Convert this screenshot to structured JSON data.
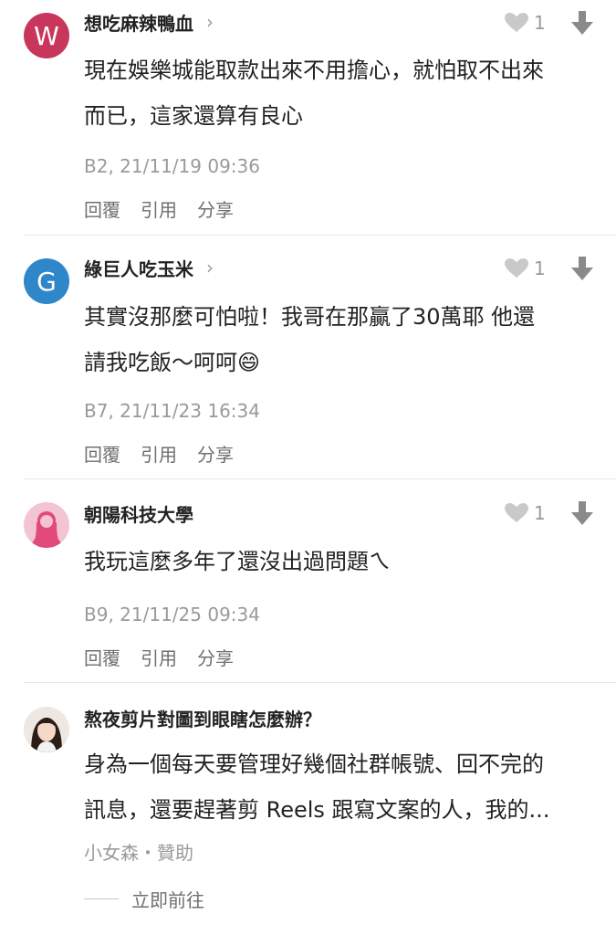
{
  "comments": [
    {
      "avatar_letter": "W",
      "avatar_color": "#c8365b",
      "username": "想吃麻辣鴨血",
      "chevron": "›",
      "likes": "1",
      "body_lines": [
        "現在娛樂城能取款出來不用擔心，就怕取不出來",
        "而已，這家還算有良心"
      ],
      "meta": "B2, 21/11/19 09:36",
      "actions": [
        "回覆",
        "引用",
        "分享"
      ]
    },
    {
      "avatar_letter": "G",
      "avatar_color": "#2f86c9",
      "username": "綠巨人吃玉米",
      "chevron": "›",
      "likes": "1",
      "body_lines": [
        "其實沒那麼可怕啦！我哥在那贏了30萬耶 他還",
        "請我吃飯～呵呵"
      ],
      "emoji": "😄",
      "meta": "B7, 21/11/23 16:34",
      "actions": [
        "回覆",
        "引用",
        "分享"
      ]
    },
    {
      "avatar_color": "#f3c4d1",
      "avatar_figure_color": "#e24a7c",
      "username": "朝陽科技大學",
      "likes": "1",
      "body_lines": [
        "我玩這麼多年了還沒出過問題ㄟ"
      ],
      "meta": "B9, 21/11/25 09:34",
      "actions": [
        "回覆",
        "引用",
        "分享"
      ]
    }
  ],
  "ad": {
    "title": "熬夜剪片對圖到眼瞎怎麼辦？",
    "body_lines": [
      "身為一個每天要管理好幾個社群帳號、回不完的",
      "訊息，還要趕著剪 Reels 跟寫文案的人，我的..."
    ],
    "sponsor": "小女森・贊助",
    "go_label": "立即前往"
  },
  "colors": {
    "text": "#222222",
    "muted": "#9a9a9a",
    "action": "#6f6f6f",
    "heart": "#c9c9c9",
    "arrow": "#8a8a8a",
    "divider": "#e8e8e8"
  },
  "icons": [
    "heart-icon",
    "down-arrow-icon",
    "chevron-right-icon"
  ]
}
